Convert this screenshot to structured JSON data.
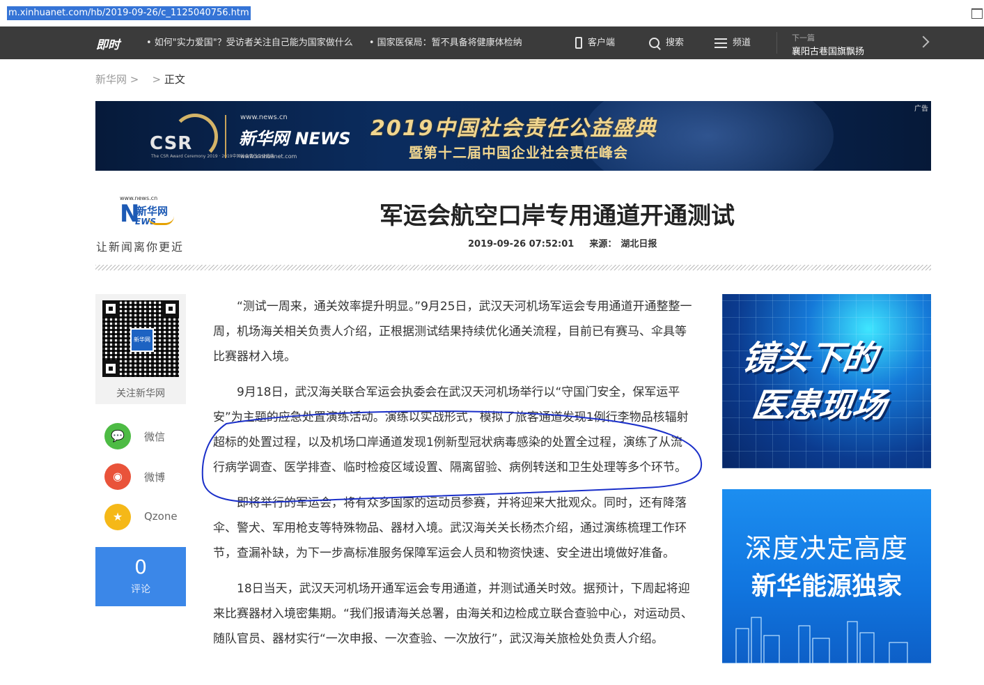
{
  "browser": {
    "url": "m.xinhuanet.com/hb/2019-09-26/c_1125040756.htm"
  },
  "topnav": {
    "logo": "即时",
    "ticker": [
      "• 如何\"实力爱国\"？受访者关注自己能为国家做什么",
      "• 国家医保局：暂不具备将健康体检纳"
    ],
    "client_label": "客户端",
    "search_label": "搜索",
    "channel_label": "频道",
    "next_label": "下一篇",
    "next_title": "襄阳古巷国旗飘扬"
  },
  "breadcrumb": {
    "home": "新华网",
    "sep1": ">",
    "sep2": ">",
    "current": "正文"
  },
  "banner": {
    "csr": "CSR",
    "csr_sub": "The CSR Award Ceremony 2019 · 2019中国社会责任公益盛典",
    "site_url": "www.news.cn",
    "brand": "新华网 NEWS",
    "site_url2": "www.xinhuanet.com",
    "title": "2019中国社会责任公益盛典",
    "subtitle": "暨第十二届中国企业社会责任峰会",
    "ad_label": "广告"
  },
  "article": {
    "logo_url": "www.news.cn",
    "logo_n": "N",
    "logo_cn": "新华网",
    "logo_ews": "EWS",
    "slogan": "让新闻离你更近",
    "title": "军运会航空口岸专用通道开通测试",
    "datetime": "2019-09-26 07:52:01",
    "source_label": "来源：",
    "source": "湖北日报",
    "paragraphs": [
      "“测试一周来，通关效率提升明显。”9月25日，武汉天河机场军运会专用通道开通整整一周，机场海关相关负责人介绍，正根据测试结果持续优化通关流程，目前已有赛马、伞具等比赛器材入境。",
      "9月18日，武汉海关联合军运会执委会在武汉天河机场举行以“守国门安全，保军运平安”为主题的应急处置演练活动。演练以实战形式，模拟了旅客通道发现1例行李物品核辐射超标的处置过程，以及机场口岸通道发现1例新型冠状病毒感染的处置全过程，演练了从流行病学调查、医学排查、临时检疫区域设置、隔离留验、病例转送和卫生处理等多个环节。",
      "即将举行的军运会，将有众多国家的运动员参赛，并将迎来大批观众。同时，还有降落伞、警犬、军用枪支等特殊物品、器材入境。武汉海关关长杨杰介绍，通过演练梳理工作环节，查漏补缺，为下一步高标准服务保障军运会人员和物资快速、安全进出境做好准备。",
      "18日当天，武汉天河机场开通军运会专用通道，并测试通关时效。据预计，下周起将迎来比赛器材入境密集期。“我们报请海关总署，由海关和边检成立联合查验中心，对运动员、随队官员、器材实行“一次申报、一次查验、一次放行”，武汉海关旅检处负责人介绍。"
    ]
  },
  "share": {
    "qr_center": "新华网",
    "follow_label": "关注新华网",
    "wechat": "微信",
    "weibo": "微博",
    "qzone": "Qzone",
    "comment_count": "0",
    "comment_label": "评论"
  },
  "ads": {
    "ad1_line1": "镜头下的",
    "ad1_line2": "医患现场",
    "ad2_line1": "深度决定高度",
    "ad2_line2": "新华能源独家"
  },
  "colors": {
    "nav_bg": "#3b3b3b",
    "comment_box": "#3b87e8",
    "annotation_pen": "#1a2fc9"
  }
}
